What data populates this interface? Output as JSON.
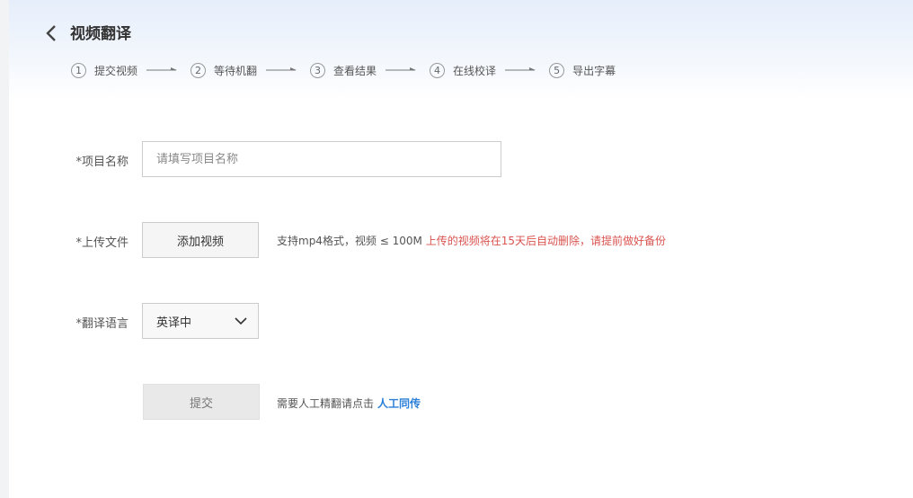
{
  "header": {
    "back_icon": "chevron-left-icon",
    "title": "视频翻译"
  },
  "steps": [
    {
      "num": "1",
      "label": "提交视频"
    },
    {
      "num": "2",
      "label": "等待机翻"
    },
    {
      "num": "3",
      "label": "查看结果"
    },
    {
      "num": "4",
      "label": "在线校译"
    },
    {
      "num": "5",
      "label": "导出字幕"
    }
  ],
  "form": {
    "project_name": {
      "label": "*项目名称",
      "placeholder": "请填写项目名称",
      "value": ""
    },
    "upload": {
      "label": "*上传文件",
      "button": "添加视频",
      "hint": "支持mp4格式，视频 ≤ 100M",
      "warning": "上传的视频将在15天后自动删除，请提前做好备份"
    },
    "language": {
      "label": "*翻译语言",
      "selected": "英译中"
    },
    "submit": {
      "button": "提交",
      "hint": "需要人工精翻请点击",
      "link": "人工同传"
    }
  },
  "colors": {
    "warning": "#d9534f",
    "link": "#2a7fd6",
    "header_gradient_top": "#e6eefb"
  }
}
